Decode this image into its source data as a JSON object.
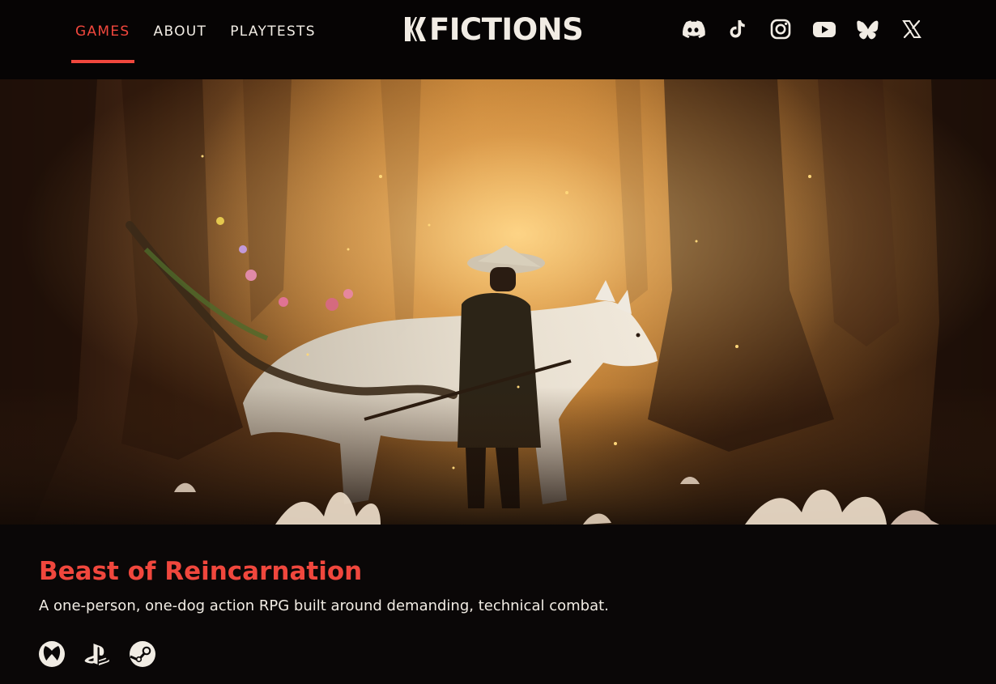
{
  "header": {
    "nav": [
      {
        "label": "GAMES",
        "active": true
      },
      {
        "label": "ABOUT",
        "active": false
      },
      {
        "label": "PLAYTESTS",
        "active": false
      }
    ],
    "logo_text": "FICTIONS",
    "social_icons": [
      "discord-icon",
      "tiktok-icon",
      "instagram-icon",
      "youtube-icon",
      "bluesky-icon",
      "x-icon"
    ]
  },
  "hero": {
    "image_subject": "warrior in straw hat standing beside giant white wolf in golden misty forest"
  },
  "game": {
    "title": "Beast of Reincarnation",
    "description": "A one-person, one-dog action RPG built around demanding, technical combat.",
    "platforms": [
      "xbox-icon",
      "playstation-icon",
      "steam-icon"
    ]
  },
  "colors": {
    "accent": "#f0473d",
    "background": "#0a0707",
    "text": "#f1ece4"
  }
}
